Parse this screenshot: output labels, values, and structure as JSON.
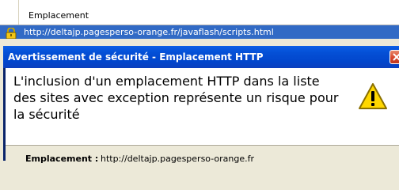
{
  "background_list": {
    "column_header": "Emplacement",
    "selected_row_url": "http://deltajp.pagesperso-orange.fr/javaflash/scripts.html"
  },
  "dialog": {
    "title": "Avertissement de sécurité - Emplacement HTTP",
    "message": "L'inclusion d'un emplacement HTTP dans la liste des sites avec exception représente un risque pour la sécurité",
    "location_label": "Emplacement :",
    "location_value": "http://deltajp.pagesperso-orange.fr"
  },
  "icons": {
    "row_icon": "padlock-icon",
    "warning": "warning-icon",
    "close": "close-icon"
  },
  "colors": {
    "selection": "#316ac5",
    "titlebar": "#0450d6",
    "close_button": "#d8472b",
    "warning_fill": "#ffd700"
  }
}
